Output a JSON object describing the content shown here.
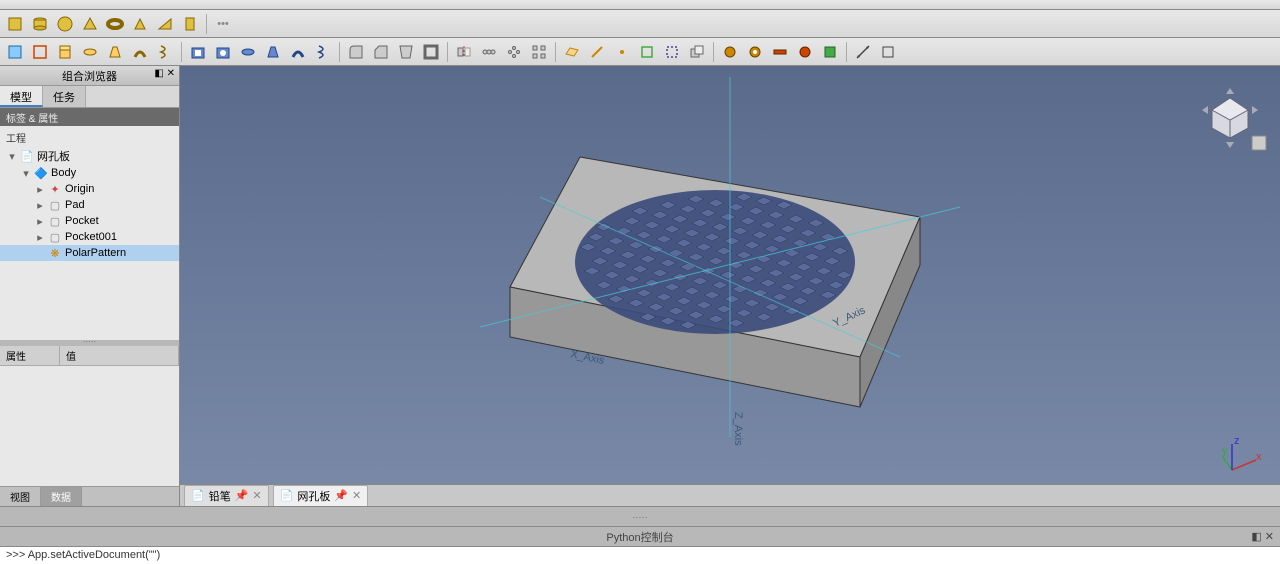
{
  "toolbars": {
    "row1_icons": [
      "box",
      "cyl",
      "cone",
      "sphere",
      "torus",
      "prism",
      "wedge",
      "pipe",
      "dot",
      "plus"
    ],
    "row2_icons": [
      "a",
      "b",
      "c",
      "d",
      "e",
      "f",
      "g",
      "h",
      "i",
      "j",
      "k",
      "l",
      "m",
      "n",
      "o",
      "p",
      "q",
      "r",
      "s",
      "t",
      "u",
      "v",
      "w",
      "x",
      "y",
      "z",
      "aa",
      "bb",
      "cc",
      "dd",
      "ee",
      "ff"
    ]
  },
  "left": {
    "combo_title": "组合浏览器",
    "tab_model": "模型",
    "tab_tasks": "任务",
    "section_labels_props": "标签 & 属性",
    "project_label": "工程",
    "tree": [
      {
        "level": 0,
        "expand": "▾",
        "icon": "📄",
        "label": "网孔板",
        "sel": false
      },
      {
        "level": 1,
        "expand": "▾",
        "icon": "🔷",
        "label": "Body",
        "sel": false,
        "color": "#2266cc"
      },
      {
        "level": 2,
        "expand": "▸",
        "icon": "✦",
        "label": "Origin",
        "sel": false,
        "color": "#cc4444"
      },
      {
        "level": 2,
        "expand": "▸",
        "icon": "▢",
        "label": "Pad",
        "sel": false,
        "color": "#888"
      },
      {
        "level": 2,
        "expand": "▸",
        "icon": "▢",
        "label": "Pocket",
        "sel": false,
        "color": "#888"
      },
      {
        "level": 2,
        "expand": "▸",
        "icon": "▢",
        "label": "Pocket001",
        "sel": false,
        "color": "#888"
      },
      {
        "level": 2,
        "expand": "",
        "icon": "❋",
        "label": "PolarPattern",
        "sel": true,
        "color": "#cc8800"
      }
    ],
    "props_section": "属性",
    "props_col_prop": "属性",
    "props_col_val": "值",
    "bottom_tab_view": "视图",
    "bottom_tab_data": "数据"
  },
  "viewport": {
    "axis_labels": {
      "x": "X_Axis",
      "y": "Y_Axis",
      "z": "Z_Axis"
    },
    "doc_tab_1": "铅笔",
    "doc_tab_2": "网孔板",
    "mini_axes": {
      "x": "x",
      "y": "y",
      "z": "z"
    }
  },
  "bottom": {
    "console_title": "Python控制台",
    "console_line": ">>> App.setActiveDocument(\"\")"
  }
}
